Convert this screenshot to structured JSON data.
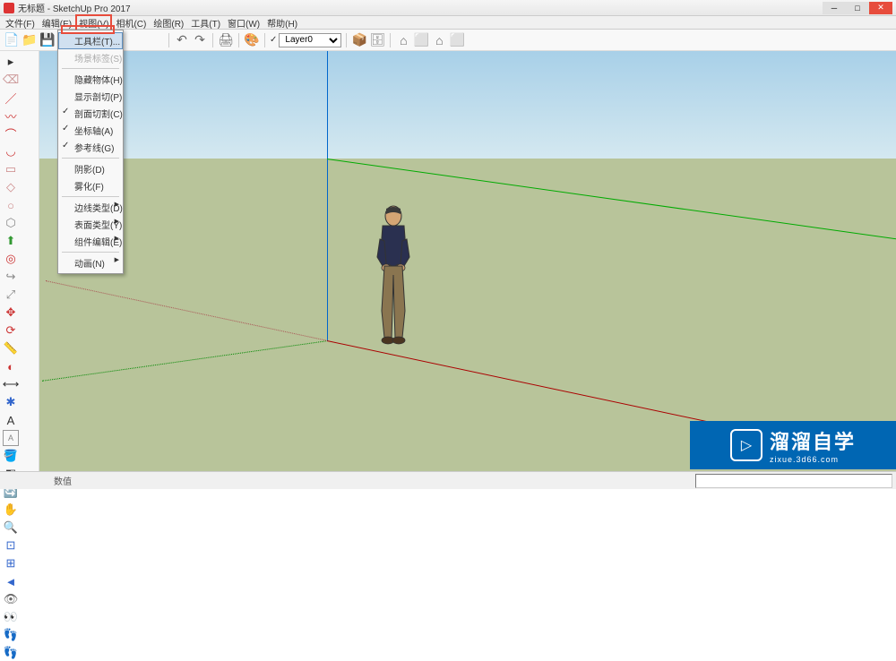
{
  "titlebar": {
    "title": "无标题 - SketchUp Pro 2017"
  },
  "menubar": {
    "items": [
      "文件(F)",
      "编辑(E)",
      "视图(V)",
      "相机(C)",
      "绘图(R)",
      "工具(T)",
      "窗口(W)",
      "帮助(H)"
    ]
  },
  "toolbar": {
    "layer_label": "Layer0"
  },
  "dropdown": {
    "items": [
      {
        "label": "工具栏(T)...",
        "highlighted": true
      },
      {
        "label": "场景标签(S)",
        "disabled": true
      },
      {
        "sep": true
      },
      {
        "label": "隐藏物体(H)"
      },
      {
        "label": "显示剖切(P)"
      },
      {
        "label": "剖面切割(C)",
        "checked": true
      },
      {
        "label": "坐标轴(A)",
        "checked": true
      },
      {
        "label": "参考线(G)",
        "checked": true
      },
      {
        "sep": true
      },
      {
        "label": "阴影(D)"
      },
      {
        "label": "雾化(F)"
      },
      {
        "sep": true
      },
      {
        "label": "边线类型(D)",
        "submenu": true
      },
      {
        "label": "表面类型(Y)",
        "submenu": true
      },
      {
        "label": "组件编辑(E)",
        "submenu": true
      },
      {
        "sep": true
      },
      {
        "label": "动画(N)",
        "submenu": true
      }
    ]
  },
  "watermark": {
    "main": "溜溜自学",
    "sub": "zixue.3d66.com"
  },
  "statusbar": {
    "value_label": "数值"
  },
  "colors": {
    "accent_red": "#e74c3c",
    "brand_blue": "#0066b3"
  }
}
